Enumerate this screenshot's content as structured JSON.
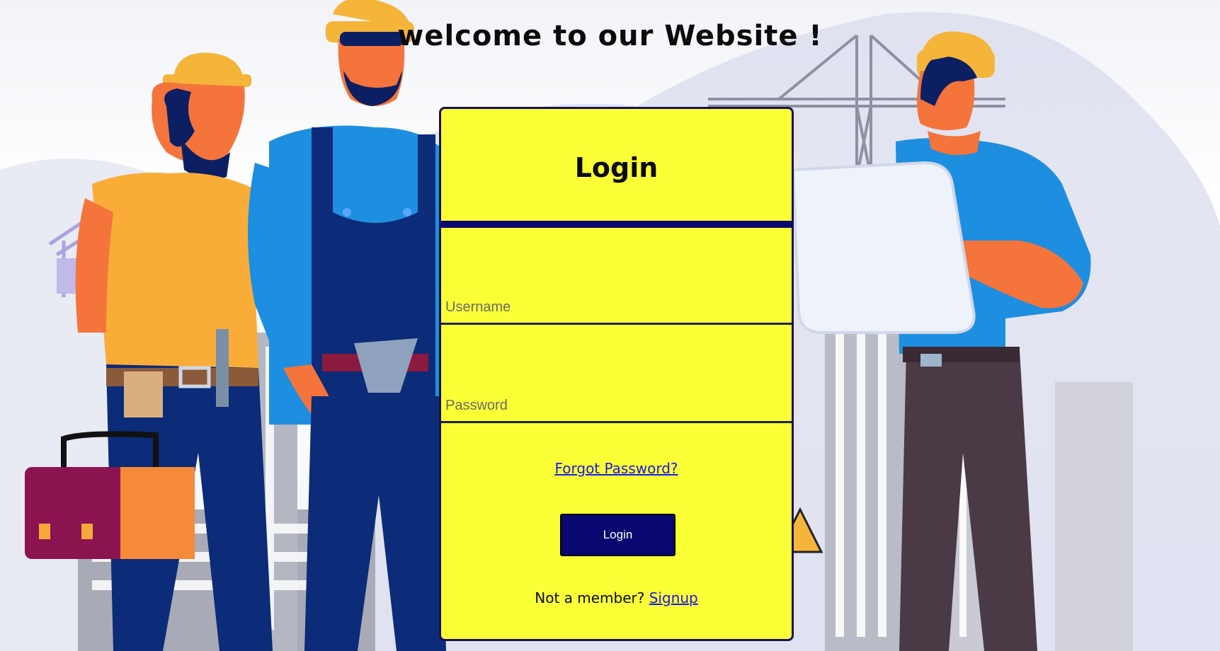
{
  "page": {
    "title": "welcome to our Website !"
  },
  "login_card": {
    "heading": "Login",
    "username_placeholder": "Username",
    "password_placeholder": "Password",
    "forgot_password": "Forgot Password?",
    "login_button": "Login",
    "signup_prompt": "Not a member?",
    "signup_link": "Signup"
  },
  "colors": {
    "card_background": "#fbff36",
    "accent_navy": "#0a0870",
    "link_blue": "#1a1ae6"
  },
  "background": {
    "description_icon": "construction-workers-illustration"
  }
}
